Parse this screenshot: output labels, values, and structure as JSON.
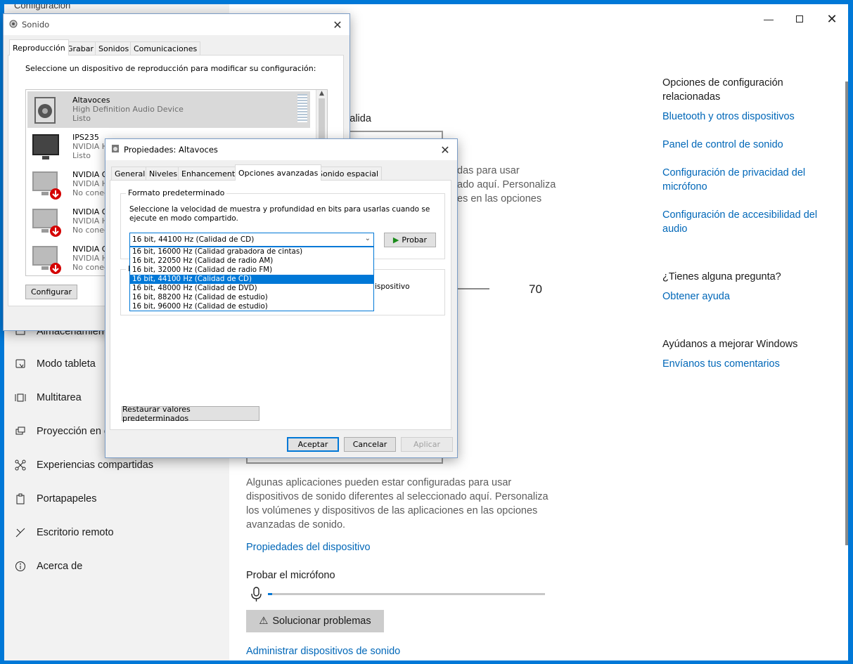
{
  "settings": {
    "top_cut_text": "Configuración",
    "nav": [
      {
        "label": "Almacenamiento",
        "icon": "storage-icon"
      },
      {
        "label": "Modo tableta",
        "icon": "tablet-mode-icon"
      },
      {
        "label": "Multitarea",
        "icon": "multitasking-icon"
      },
      {
        "label": "Proyección en este equipo",
        "icon": "projection-icon"
      },
      {
        "label": "Experiencias compartidas",
        "icon": "shared-experiences-icon"
      },
      {
        "label": "Portapapeles",
        "icon": "clipboard-icon"
      },
      {
        "label": "Escritorio remoto",
        "icon": "remote-desktop-icon"
      },
      {
        "label": "Acerca de",
        "icon": "info-icon"
      }
    ],
    "main": {
      "output_label_cut": "salida",
      "output_body_cut": [
        "das para usar",
        "ado aquí. Personaliza",
        "es en las opciones"
      ],
      "volume_value": "70",
      "input_body": [
        "Algunas aplicaciones pueden estar configuradas para usar",
        "dispositivos de sonido diferentes al seleccionado aquí. Personaliza",
        "los volúmenes y dispositivos de las aplicaciones en las opciones",
        "avanzadas de sonido."
      ],
      "device_props_link": "Propiedades del dispositivo",
      "test_mic_label": "Probar el micrófono",
      "troubleshoot_button": "Solucionar problemas",
      "manage_devices_link": "Administrar dispositivos de sonido"
    },
    "related": {
      "heading_line1": "Opciones de configuración",
      "heading_line2": "relacionadas",
      "links": [
        "Bluetooth y otros dispositivos",
        "Panel de control de sonido",
        "Configuración de privacidad del",
        "micrófono",
        "Configuración de accesibilidad del",
        "audio"
      ],
      "question_heading": "¿Tienes alguna pregunta?",
      "help_link": "Obtener ayuda",
      "improve_heading": "Ayúdanos a mejorar Windows",
      "feedback_link": "Envíanos tus comentarios"
    }
  },
  "sound_dialog": {
    "title": "Sonido",
    "tabs": [
      "Reproducción",
      "Grabar",
      "Sonidos",
      "Comunicaciones"
    ],
    "instruction": "Seleccione un dispositivo de reproducción para modificar su configuración:",
    "devices": [
      {
        "name": "Altavoces",
        "desc": "High Definition Audio Device",
        "status": "Listo"
      },
      {
        "name": "IPS235",
        "desc": "NVIDIA H",
        "status": "Listo"
      },
      {
        "name": "NVIDIA O",
        "desc": "NVIDIA H",
        "status": "No conect"
      },
      {
        "name": "NVIDIA O",
        "desc": "NVIDIA H",
        "status": "No conect"
      },
      {
        "name": "NVIDIA O",
        "desc": "NVIDIA H",
        "status": "No conect"
      }
    ],
    "configure_button": "Configurar"
  },
  "props_dialog": {
    "title": "Propiedades: Altavoces",
    "tabs": [
      "General",
      "Niveles",
      "Enhancements",
      "Opciones avanzadas",
      "Sonido espacial"
    ],
    "group_title": "Formato predeterminado",
    "group_desc_line1": "Seleccione la velocidad de muestra y profundidad en bits para usarlas cuando se",
    "group_desc_line2": "ejecute en modo compartido.",
    "selected_format": "16 bit, 44100 Hz (Calidad de CD)",
    "test_button": "Probar",
    "options": [
      "16 bit, 16000 Hz (Calidad grabadora de cintas)",
      "16 bit, 22050 Hz (Calidad de radio AM)",
      "16 bit, 32000 Hz (Calidad de radio FM)",
      "16 bit, 44100 Hz (Calidad de CD)",
      "16 bit, 48000 Hz (Calidad de DVD)",
      "16 bit, 88200 Hz (Calidad de estudio)",
      "16 bit, 96000 Hz (Calidad de estudio)"
    ],
    "exclusive_group_letter": "M",
    "exclusive_cut_text": "ispositivo",
    "restore_button": "Restaurar valores predeterminados",
    "ok_button": "Aceptar",
    "cancel_button": "Cancelar",
    "apply_button": "Aplicar"
  }
}
